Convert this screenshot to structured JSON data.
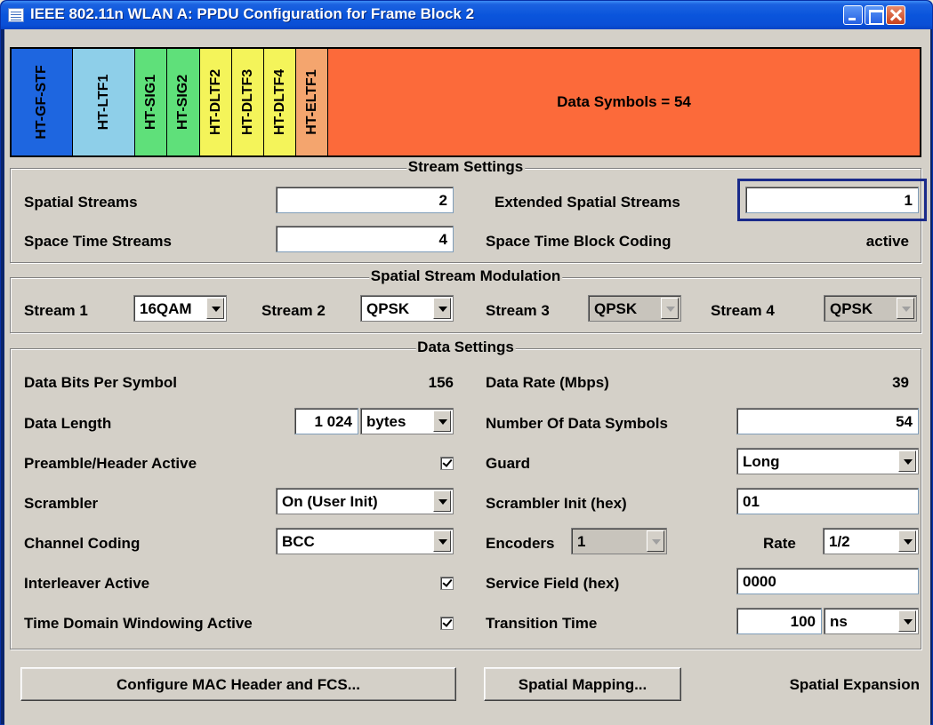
{
  "window": {
    "title": "IEEE 802.11n WLAN  A: PPDU Configuration for Frame Block 2"
  },
  "ppdu": {
    "fields": [
      {
        "label": "HT-GF-STF",
        "color": "#1e66e0"
      },
      {
        "label": "HT-LTF1",
        "color": "#8ecfe9"
      },
      {
        "label": "HT-SIG1",
        "color": "#5fe07a"
      },
      {
        "label": "HT-SIG2",
        "color": "#5fe07a"
      },
      {
        "label": "HT-DLTF2",
        "color": "#f4f45a"
      },
      {
        "label": "HT-DLTF3",
        "color": "#f4f45a"
      },
      {
        "label": "HT-DLTF4",
        "color": "#f4f45a"
      },
      {
        "label": "HT-ELTF1",
        "color": "#f4a56e"
      }
    ],
    "data_label": "Data Symbols = 54",
    "data_color": "#fc6a3a"
  },
  "stream_settings": {
    "title": "Stream Settings",
    "spatial_streams_label": "Spatial Streams",
    "spatial_streams_value": "2",
    "extended_label": "Extended Spatial Streams",
    "extended_value": "1",
    "space_time_label": "Space Time Streams",
    "space_time_value": "4",
    "stbc_label": "Space Time Block Coding",
    "stbc_value": "active"
  },
  "modulation": {
    "title": "Spatial Stream Modulation",
    "s1_label": "Stream 1",
    "s1_value": "16QAM",
    "s2_label": "Stream 2",
    "s2_value": "QPSK",
    "s3_label": "Stream 3",
    "s3_value": "QPSK",
    "s4_label": "Stream 4",
    "s4_value": "QPSK"
  },
  "data_settings": {
    "title": "Data Settings",
    "bits_label": "Data Bits Per Symbol",
    "bits_value": "156",
    "rate_label": "Data Rate (Mbps)",
    "rate_value": "39",
    "length_label": "Data Length",
    "length_value": "1 024",
    "length_unit": "bytes",
    "num_symbols_label": "Number Of Data Symbols",
    "num_symbols_value": "54",
    "preamble_label": "Preamble/Header Active",
    "guard_label": "Guard",
    "guard_value": "Long",
    "scrambler_label": "Scrambler",
    "scrambler_value": "On (User Init)",
    "scr_init_label": "Scrambler Init (hex)",
    "scr_init_value": "01",
    "coding_label": "Channel Coding",
    "coding_value": "BCC",
    "encoders_label": "Encoders",
    "encoders_value": "1",
    "rate_sel_label": "Rate",
    "rate_sel_value": "1/2",
    "interleaver_label": "Interleaver Active",
    "service_label": "Service Field (hex)",
    "service_value": "0000",
    "windowing_label": "Time Domain Windowing Active",
    "transition_label": "Transition Time",
    "transition_value": "100",
    "transition_unit": "ns"
  },
  "footer": {
    "mac_button": "Configure MAC Header and FCS...",
    "mapping_button": "Spatial Mapping...",
    "mapping_value": "Spatial Expansion"
  }
}
